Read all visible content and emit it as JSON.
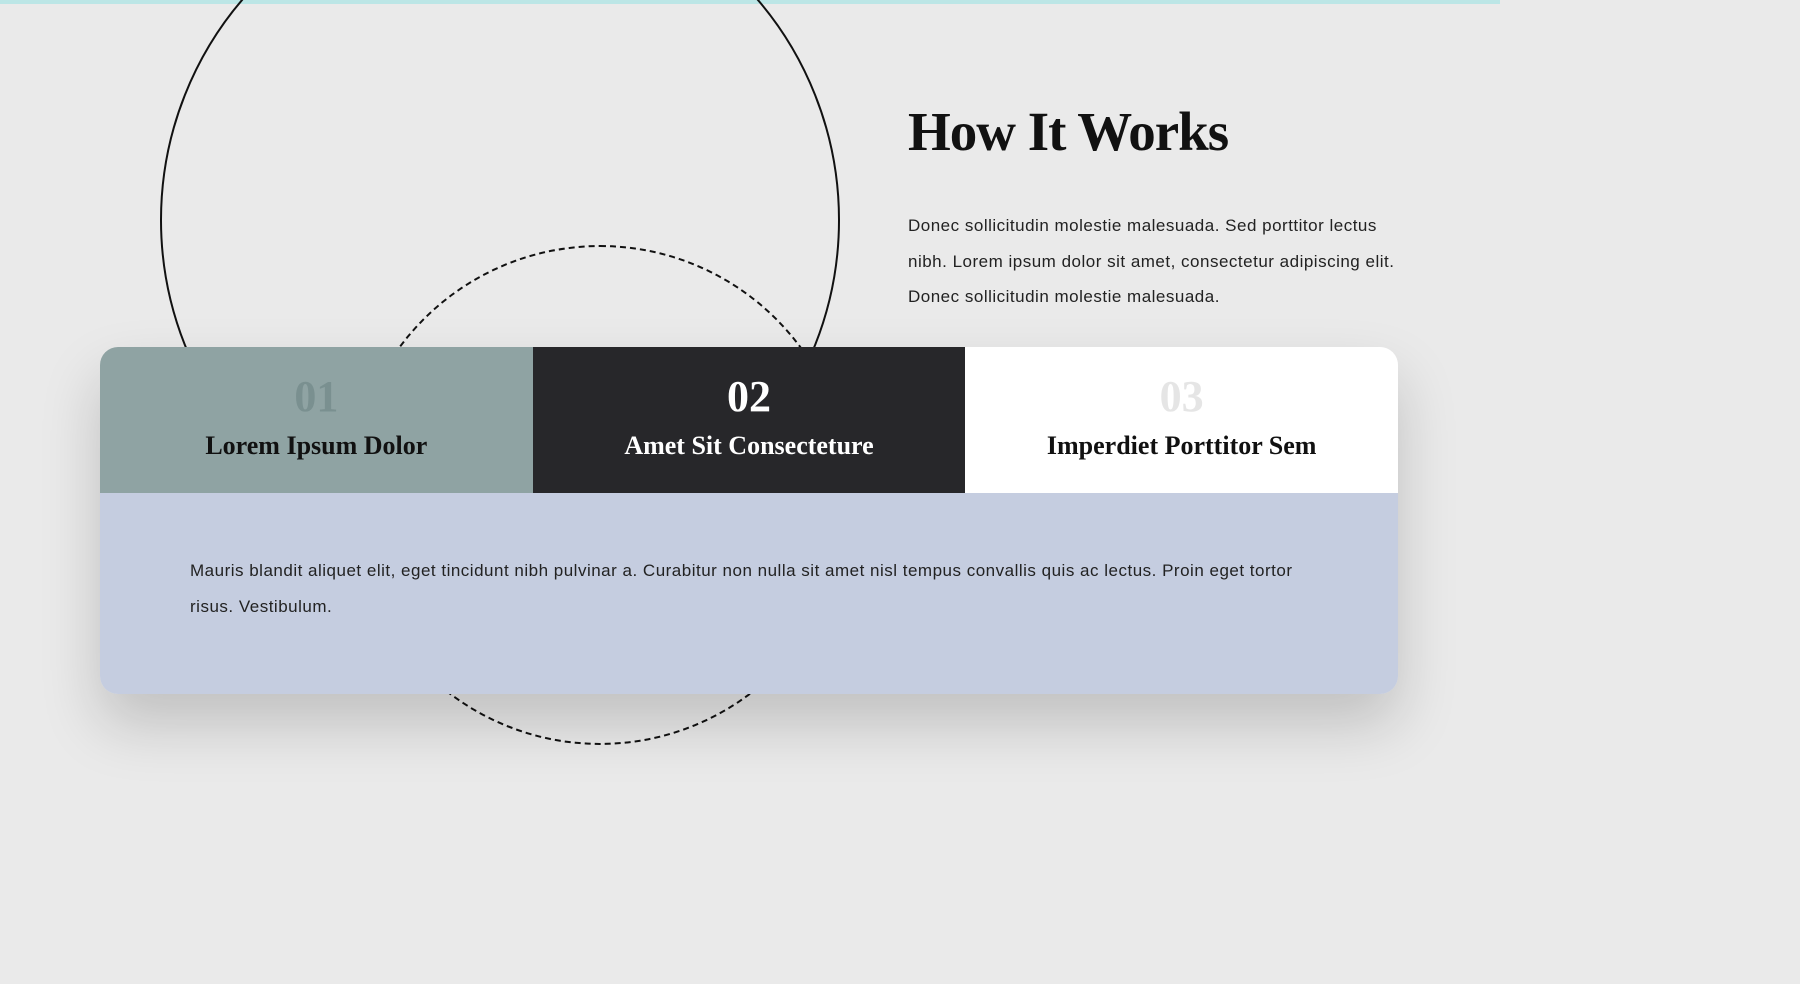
{
  "heading": {
    "title": "How It Works",
    "description": "Donec sollicitudin molestie malesuada. Sed porttitor lectus nibh. Lorem ipsum dolor sit amet, consectetur adipiscing elit. Donec sollicitudin molestie malesuada."
  },
  "tabs": [
    {
      "number": "01",
      "title": "Lorem Ipsum Dolor"
    },
    {
      "number": "02",
      "title": "Amet Sit Consecteture"
    },
    {
      "number": "03",
      "title": "Imperdiet Porttitor Sem"
    }
  ],
  "tab_content": "Mauris blandit aliquet elit, eget tincidunt nibh pulvinar a. Curabitur non nulla sit amet nisl tempus convallis quis ac lectus. Proin eget tortor risus. Vestibulum."
}
